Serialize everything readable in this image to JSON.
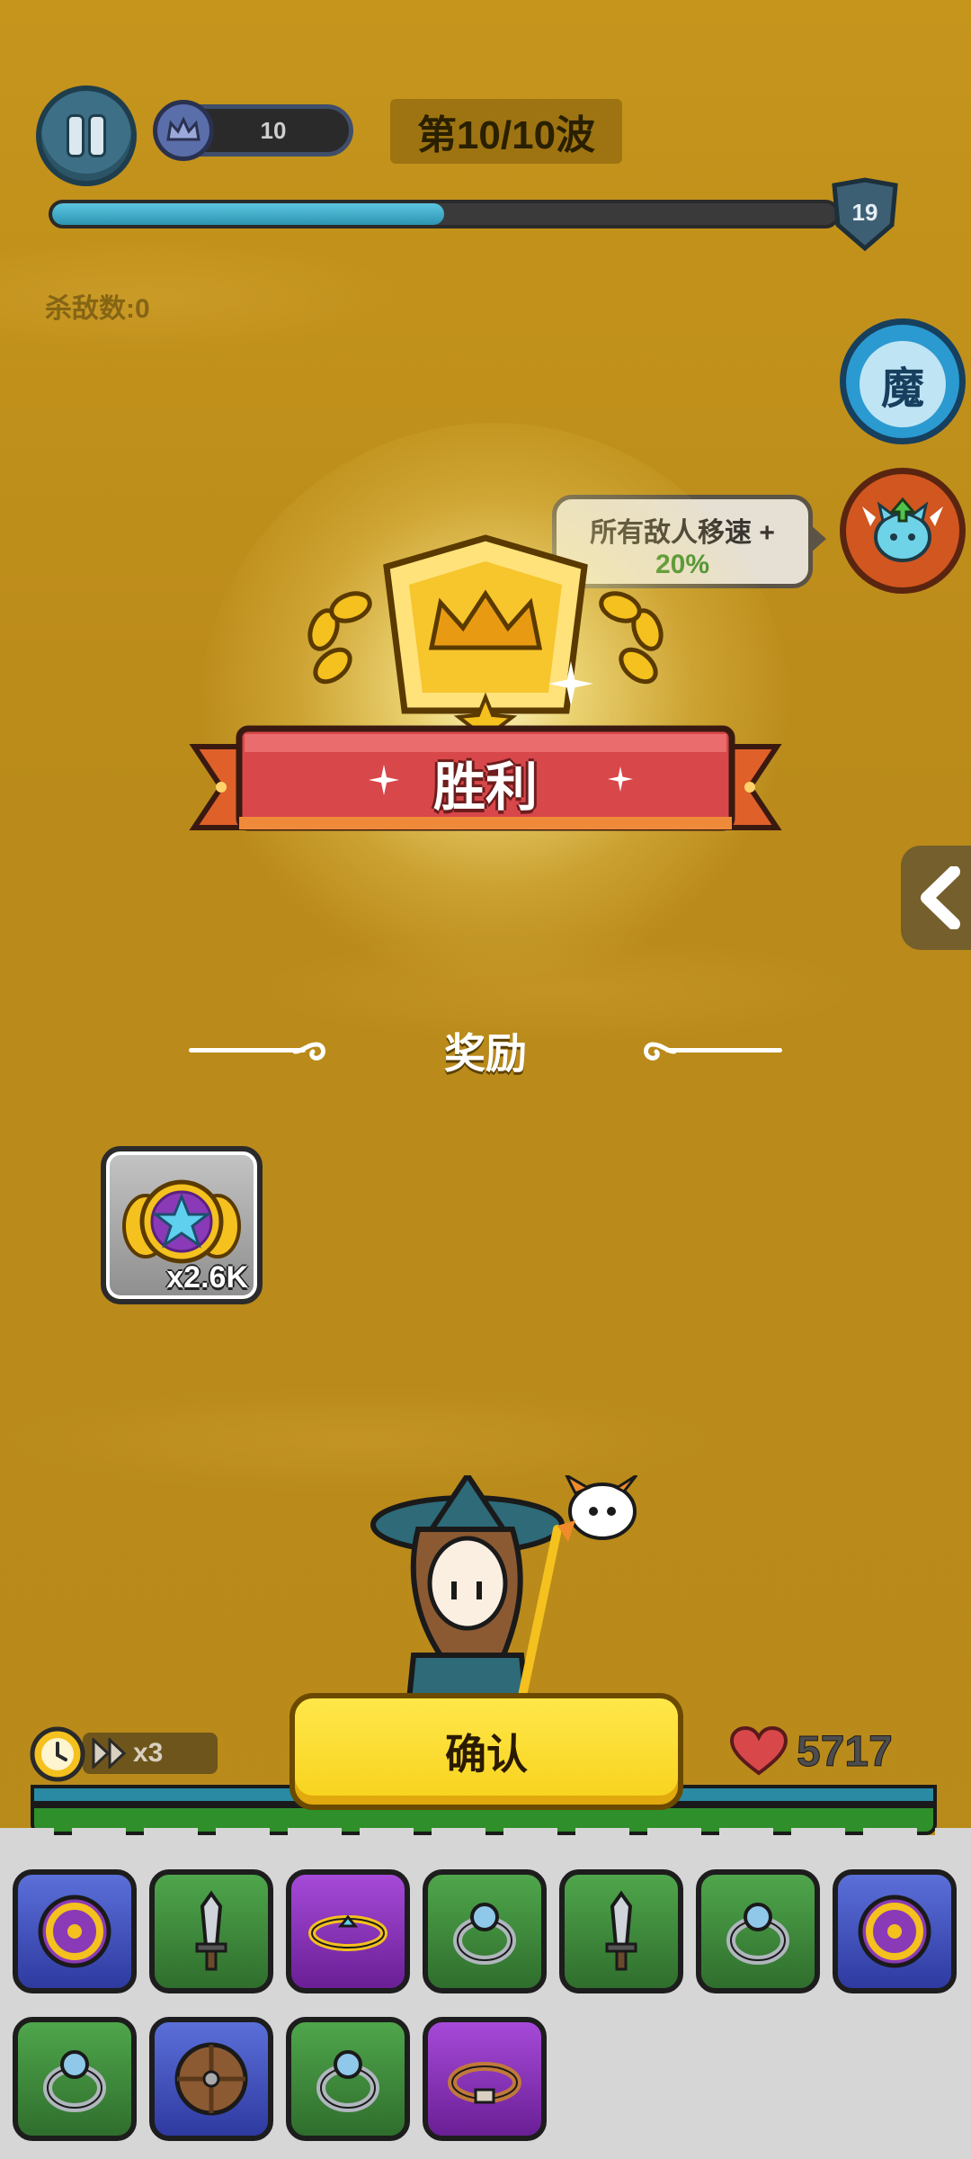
{
  "hud": {
    "crown_value": "10",
    "wave_label": "第10/10波",
    "wave_progress": 0.5,
    "level": "19",
    "kills_label": "杀敌数:0"
  },
  "side": {
    "magic_label": "魔",
    "tip_line1": "所有敌人移速 +",
    "tip_line2": "20%"
  },
  "victory": {
    "title": "胜利",
    "reward_heading": "奖励",
    "reward_qty": "x2.6K"
  },
  "bottom": {
    "speed_label": "x3",
    "hp_value": "5717",
    "confirm_label": "确认"
  },
  "equipment_slots": [
    {
      "icon": "shield-icon",
      "rarity": "blue"
    },
    {
      "icon": "sword-icon",
      "rarity": "green"
    },
    {
      "icon": "tiara-icon",
      "rarity": "purple"
    },
    {
      "icon": "ring-icon",
      "rarity": "green"
    },
    {
      "icon": "sword-icon",
      "rarity": "green"
    },
    {
      "icon": "ring-icon",
      "rarity": "green"
    },
    {
      "icon": "shield-icon",
      "rarity": "blue"
    },
    {
      "icon": "ring-icon",
      "rarity": "green"
    },
    {
      "icon": "round-shield-icon",
      "rarity": "blue"
    },
    {
      "icon": "ring-icon",
      "rarity": "green"
    },
    {
      "icon": "belt-icon",
      "rarity": "purple"
    }
  ]
}
